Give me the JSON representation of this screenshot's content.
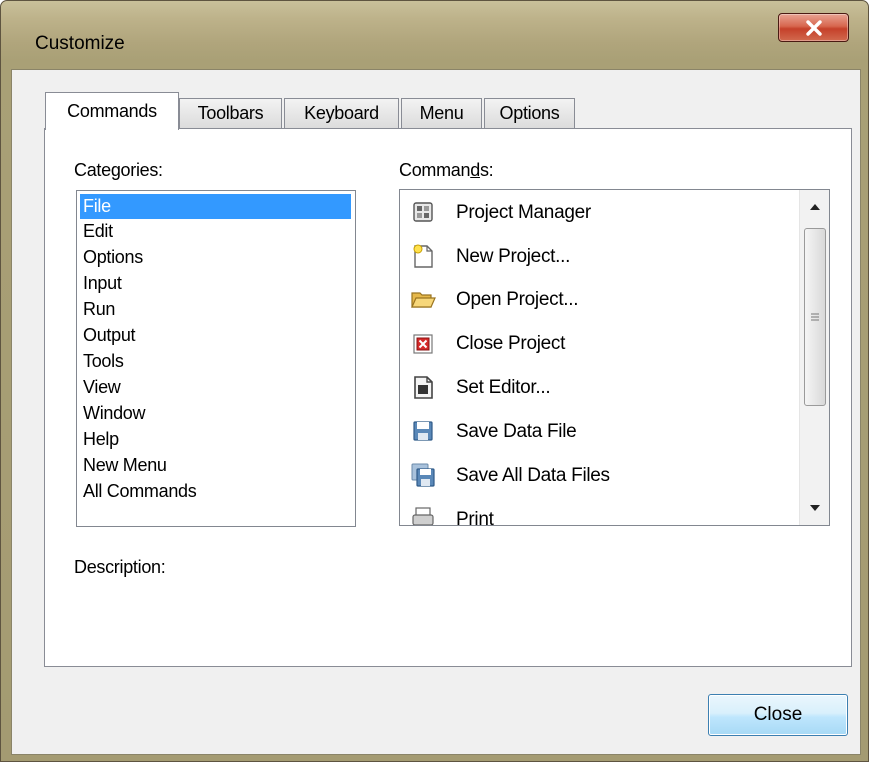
{
  "window": {
    "title": "Customize"
  },
  "tabs": [
    {
      "label": "Commands",
      "active": true
    },
    {
      "label": "Toolbars",
      "active": false
    },
    {
      "label": "Keyboard",
      "active": false
    },
    {
      "label": "Menu",
      "active": false
    },
    {
      "label": "Options",
      "active": false
    }
  ],
  "categories": {
    "label_pre": "Cate",
    "label_u": "g",
    "label_post": "ories:",
    "items": [
      "File",
      "Edit",
      "Options",
      "Input",
      "Run",
      "Output",
      "Tools",
      "View",
      "Window",
      "Help",
      "New Menu",
      "All Commands"
    ],
    "selected": "File"
  },
  "commands": {
    "label_pre": "Comman",
    "label_u": "d",
    "label_post": "s:",
    "items": [
      {
        "label": "Project Manager",
        "icon": "project-manager-icon"
      },
      {
        "label": "New Project...",
        "icon": "new-project-icon"
      },
      {
        "label": "Open Project...",
        "icon": "open-folder-icon"
      },
      {
        "label": "Close Project",
        "icon": "close-project-icon"
      },
      {
        "label": "Set Editor...",
        "icon": "set-editor-icon"
      },
      {
        "label": "Save Data File",
        "icon": "floppy-disk-icon"
      },
      {
        "label": "Save All Data Files",
        "icon": "save-all-icon"
      },
      {
        "label": "Print",
        "icon": "printer-icon"
      }
    ]
  },
  "description": {
    "label": "Description:"
  },
  "buttons": {
    "close_label": "Close"
  },
  "colors": {
    "selection": "#3399ff",
    "title_close": "#c5412a"
  }
}
